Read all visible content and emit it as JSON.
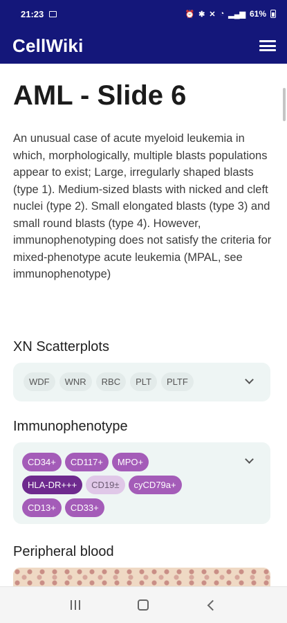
{
  "status_bar": {
    "time": "21:23",
    "battery": "61%"
  },
  "app": {
    "title": "CellWiki"
  },
  "page": {
    "title": "AML - Slide 6",
    "description": "An unusual case of acute myeloid leukemia in which, morphologically, multiple blasts populations appear to exist; Large, irregularly shaped blasts (type 1). Medium-sized blasts with nicked and cleft nuclei (type 2). Small elongated blasts (type 3) and small round blasts (type 4). However, immunophenotyping does not satisfy the criteria for mixed-phenotype acute leukemia (MPAL, see immunophenotype)"
  },
  "scatterplots": {
    "title": "XN Scatterplots",
    "chips": [
      "WDF",
      "WNR",
      "RBC",
      "PLT",
      "PLTF"
    ]
  },
  "immunophenotype": {
    "title": "Immunophenotype",
    "chips": [
      "CD34+",
      "CD117+",
      "MPO+",
      "HLA-DR+++",
      "CD19±",
      "cyCD79a+",
      "CD13+",
      "CD33+"
    ]
  },
  "peripheral_blood": {
    "title": "Peripheral blood"
  },
  "colors": {
    "header": "#14177a",
    "chip_purple": "#a45cb8",
    "chip_dark": "#6e2a8e",
    "chip_light": "#e0c8e8"
  }
}
